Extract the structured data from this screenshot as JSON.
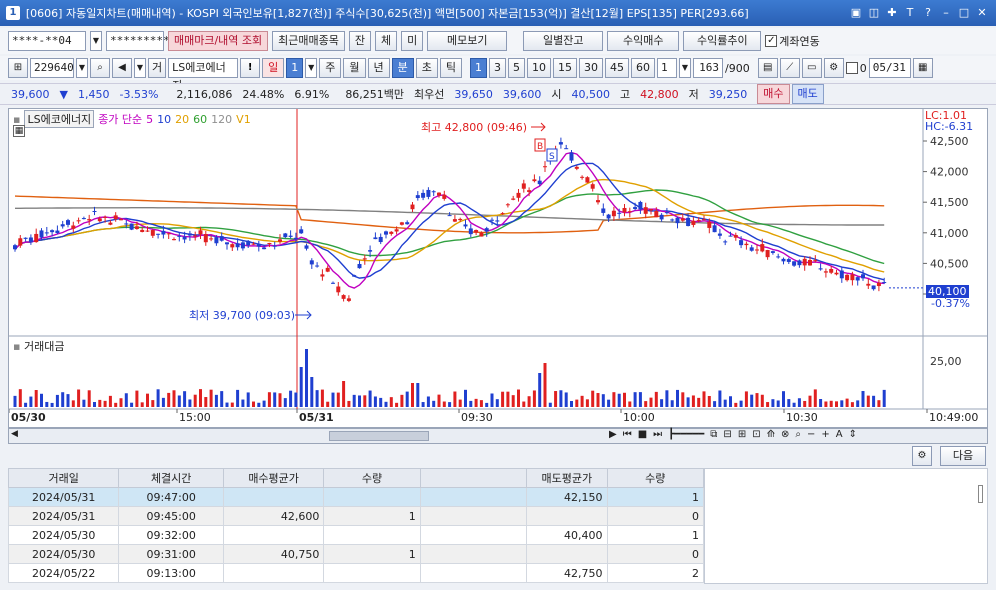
{
  "window": {
    "app_icon": "1",
    "title": "[0606] 자동일지차트(매매내역) - KOSPI 외국인보유[1,827(천)] 주식수[30,625(천)] 액면[500] 자본금[153(억)] 결산[12월] EPS[135] PER[293.66]"
  },
  "toolbar1": {
    "account": "****-**04",
    "password": "*********",
    "mark_button": "매매마크/내역 조회",
    "recent_button": "최근매매종목",
    "btn_jan": "잔",
    "btn_che": "체",
    "btn_mi": "미",
    "memo_button": "메모보기",
    "daily_balance_button": "일별잔고",
    "profit_button": "수익매수",
    "return_trend_button": "수익률추이",
    "account_link_label": "계좌연동"
  },
  "toolbar2": {
    "code": "229640",
    "name_prefix": "거",
    "name": "LS에코에너지",
    "exclaim": "!",
    "day": "일",
    "day_num": "1",
    "week": "주",
    "month": "월",
    "year": "년",
    "minute": "분",
    "second": "초",
    "tick": "틱",
    "intervals": [
      "1",
      "3",
      "5",
      "10",
      "15",
      "30",
      "45",
      "60"
    ],
    "selected_interval": "1",
    "count_value": "1",
    "count": "163",
    "count_total": "/900",
    "zero_label": "0",
    "date": "05/31"
  },
  "quote": {
    "price": "39,600",
    "price_arrow": "▼",
    "change": "1,450",
    "change_pct": "-3.53%",
    "volume": "2,116,086",
    "turnover_rate": "24.48%",
    "ratio": "6.91%",
    "amount": "86,251백만",
    "best_bid_label": "최우선",
    "best_bid": "39,650",
    "best_ask": "39,600",
    "open_label": "시",
    "open": "40,500",
    "high_label": "고",
    "high": "42,800",
    "low_label": "저",
    "low": "39,250",
    "buy_button": "매수",
    "sell_button": "매도"
  },
  "chart_data": {
    "type": "candlestick",
    "legend": {
      "name": "LS에코에너지",
      "price_label": "종가 단순",
      "ma": [
        "5",
        "10",
        "20",
        "60",
        "120"
      ],
      "ma_colors": [
        "#c000c0",
        "#1f3fd0",
        "#e0a000",
        "#30a030",
        "#909090"
      ],
      "v_label": "V1"
    },
    "lc_label": "LC:1.01",
    "hc_label": "HC:-6.31",
    "y_ticks": [
      "42,500",
      "42,000",
      "41,500",
      "41,000",
      "40,500",
      "40,000"
    ],
    "current_price_label": "40,100",
    "current_pct": "-0.37%",
    "high_annotation": "최고 42,800 (09:46)",
    "low_annotation": "최저 39,700 (09:03)",
    "marker_b": "B",
    "marker_s": "S",
    "volume_title": "거래대금",
    "volume_tick": "25,00",
    "x_labels": [
      "05/30",
      "15:00",
      "05/31",
      "09:30",
      "10:00",
      "10:30",
      "10:49:00"
    ],
    "colors": {
      "up": "#e02020",
      "down": "#1f3fd0",
      "orange_line": "#e06010",
      "gray_line": "#808080",
      "green_line": "#30a040",
      "yellow_line": "#e0a000"
    }
  },
  "bottom_toolbar": {
    "next_button": "다음",
    "settings_icon": "gear-icon"
  },
  "table": {
    "headers": [
      "거래일",
      "체결시간",
      "매수평균가",
      "수량",
      "",
      "매도평균가",
      "수량"
    ],
    "rows": [
      [
        "2024/05/31",
        "09:47:00",
        "",
        "",
        "",
        "42,150",
        "1"
      ],
      [
        "2024/05/31",
        "09:45:00",
        "42,600",
        "1",
        "",
        "",
        "0"
      ],
      [
        "2024/05/30",
        "09:32:00",
        "",
        "",
        "",
        "40,400",
        "1"
      ],
      [
        "2024/05/30",
        "09:31:00",
        "40,750",
        "1",
        "",
        "",
        "0"
      ],
      [
        "2024/05/22",
        "09:13:00",
        "",
        "",
        "",
        "42,750",
        "2"
      ]
    ]
  }
}
